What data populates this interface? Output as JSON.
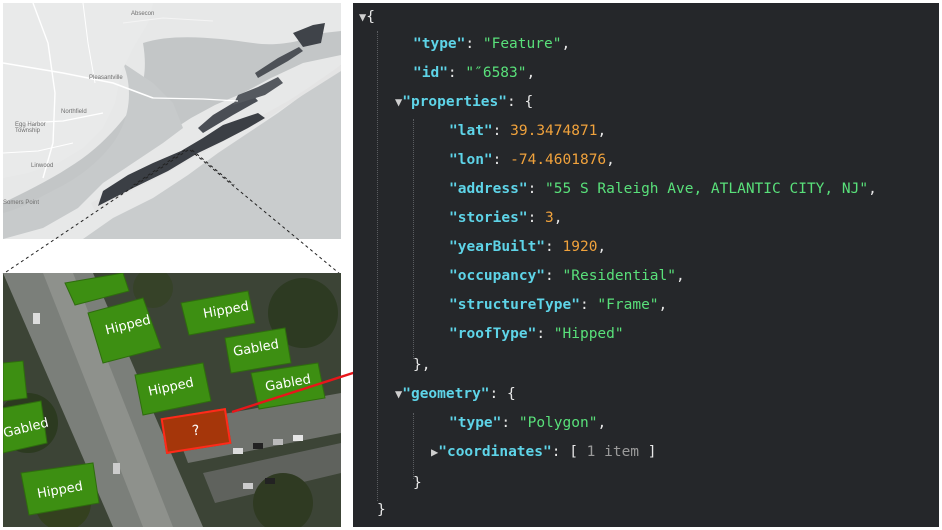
{
  "map": {
    "labels": {
      "absecon": "Absecon",
      "pleasantville": "Pleasantville",
      "northfield": "Northfield",
      "egg_harbor": "Egg Harbor",
      "township": "Township",
      "linwood": "Linwood",
      "somers_point": "Somers Point"
    }
  },
  "aerial": {
    "roofs": [
      "Hipped",
      "Hipped",
      "Gabled",
      "Hipped",
      "Gabled",
      "Gabled",
      "Hipped"
    ],
    "unknown_label": "?"
  },
  "json_viewer": {
    "open_brace": "{",
    "close_brace": "}",
    "type_key": "\"type\"",
    "type_value": "\"Feature\"",
    "id_key": "\"id\"",
    "id_value": "\"″6583\"",
    "properties_key": "\"properties\"",
    "props": {
      "lat_key": "\"lat\"",
      "lat_value": "39.3474871",
      "lon_key": "\"lon\"",
      "lon_value": "-74.4601876",
      "address_key": "\"address\"",
      "address_value": "\"55 S Raleigh Ave, ATLANTIC CITY, NJ\"",
      "stories_key": "\"stories\"",
      "stories_value": "3",
      "yearbuilt_key": "\"yearBuilt\"",
      "yearbuilt_value": "1920",
      "occupancy_key": "\"occupancy\"",
      "occupancy_value": "\"Residential\"",
      "structuretype_key": "\"structureType\"",
      "structuretype_value": "\"Frame\"",
      "rooftype_key": "\"roofType\"",
      "rooftype_value": "\"Hipped\""
    },
    "geometry_key": "\"geometry\"",
    "geom": {
      "type_key": "\"type\"",
      "type_value": "\"Polygon\"",
      "coords_key": "\"coordinates\"",
      "coords_summary": "1 item"
    }
  },
  "colors": {
    "json_bg": "#25272a",
    "json_key": "#5ed4e8",
    "json_string": "#59e07a",
    "json_number": "#f0a23c",
    "roof_green": "#3d8f12",
    "unknown_fill": "#a5360a",
    "arrow_red": "#e8161a"
  }
}
